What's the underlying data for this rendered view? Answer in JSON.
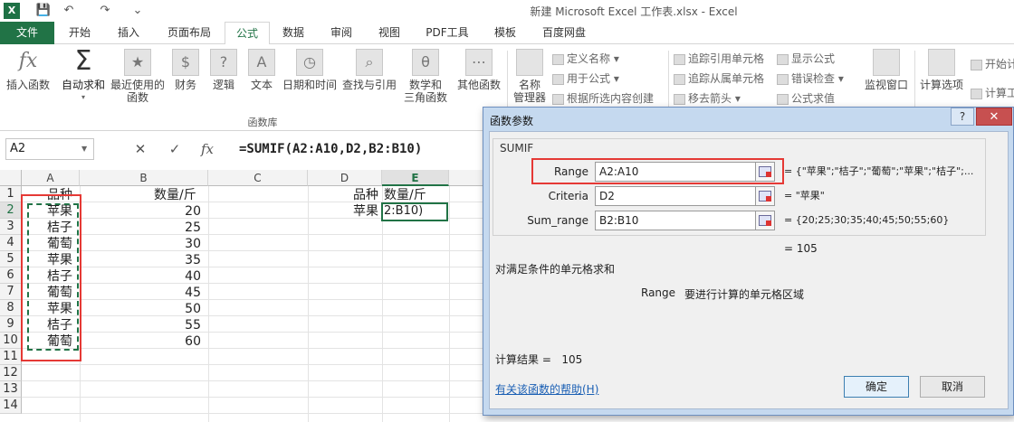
{
  "window": {
    "title": "新建 Microsoft Excel 工作表.xlsx - Excel",
    "app_icon": "X"
  },
  "qat": {
    "save": "💾",
    "undo": "↶",
    "redo": "↷",
    "more": "⌄"
  },
  "tabs": [
    {
      "label": "文件"
    },
    {
      "label": "开始"
    },
    {
      "label": "插入"
    },
    {
      "label": "页面布局"
    },
    {
      "label": "公式"
    },
    {
      "label": "数据"
    },
    {
      "label": "审阅"
    },
    {
      "label": "视图"
    },
    {
      "label": "PDF工具"
    },
    {
      "label": "模板"
    },
    {
      "label": "百度网盘"
    }
  ],
  "ribbon": {
    "insert_function": {
      "line1": "插入函数",
      "icon": "fx"
    },
    "autosum": {
      "line1": "自动求和",
      "icon": "Σ"
    },
    "recent": {
      "line1": "最近使用的",
      "line2": "函数",
      "icon": "★"
    },
    "finance": {
      "line1": "财务",
      "icon": "$"
    },
    "logic": {
      "line1": "逻辑",
      "icon": "?"
    },
    "text": {
      "line1": "文本",
      "icon": "A"
    },
    "datetime": {
      "line1": "日期和时间",
      "icon": "◷"
    },
    "lookup": {
      "line1": "查找与引用",
      "icon": "⌕"
    },
    "math": {
      "line1": "数学和",
      "line2": "三角函数",
      "icon": "θ"
    },
    "other": {
      "line1": "其他函数",
      "icon": "⋯"
    },
    "group_label": "函数库",
    "name_manager": {
      "line1": "名称",
      "line2": "管理器"
    },
    "define_name": "定义名称",
    "use_in_formula": "用于公式",
    "create_from_selection": "根据所选内容创建",
    "trace_precedents": "追踪引用单元格",
    "trace_dependents": "追踪从属单元格",
    "remove_arrows": "移去箭头",
    "show_formulas": "显示公式",
    "error_checking": "错误检查",
    "evaluate_formula": "公式求值",
    "watch_window": "监视窗口",
    "calc_options": "计算选项",
    "calc_now": "开始计",
    "calc_sheet": "计算工"
  },
  "formula_bar": {
    "name_box": "A2",
    "cancel": "✕",
    "enter": "✓",
    "fx": "fx",
    "formula": "=SUMIF(A2:A10,D2,B2:B10)"
  },
  "grid": {
    "columns": [
      "A",
      "B",
      "C",
      "D",
      "E"
    ],
    "rows": [
      "1",
      "2",
      "3",
      "4",
      "5",
      "6",
      "7",
      "8",
      "9",
      "10",
      "11",
      "12",
      "13",
      "14"
    ],
    "header_a": "品种",
    "header_b": "数量/斤",
    "items": [
      {
        "name": "苹果",
        "qty": "20"
      },
      {
        "name": "桔子",
        "qty": "25"
      },
      {
        "name": "葡萄",
        "qty": "30"
      },
      {
        "name": "苹果",
        "qty": "35"
      },
      {
        "name": "桔子",
        "qty": "40"
      },
      {
        "name": "葡萄",
        "qty": "45"
      },
      {
        "name": "苹果",
        "qty": "50"
      },
      {
        "name": "桔子",
        "qty": "55"
      },
      {
        "name": "葡萄",
        "qty": "60"
      }
    ],
    "d1": "品种",
    "e1": "数量/斤",
    "d2": "苹果",
    "e2": "2:B10)"
  },
  "dialog": {
    "title": "函数参数",
    "help_btn": "?",
    "close_btn": "✕",
    "function_name": "SUMIF",
    "args": [
      {
        "label": "Range",
        "value": "A2:A10",
        "result": "= {\"苹果\";\"桔子\";\"葡萄\";\"苹果\";\"桔子\";..."
      },
      {
        "label": "Criteria",
        "value": "D2",
        "result": "= \"苹果\""
      },
      {
        "label": "Sum_range",
        "value": "B2:B10",
        "result": "= {20;25;30;35;40;45;50;55;60}"
      }
    ],
    "overall_result": "= 105",
    "description": "对满足条件的单元格求和",
    "arg_help_name": "Range",
    "arg_help_text": "要进行计算的单元格区域",
    "calc_result": "计算结果 =   105",
    "help_link": "有关该函数的帮助(H)",
    "ok": "确定",
    "cancel": "取消"
  }
}
